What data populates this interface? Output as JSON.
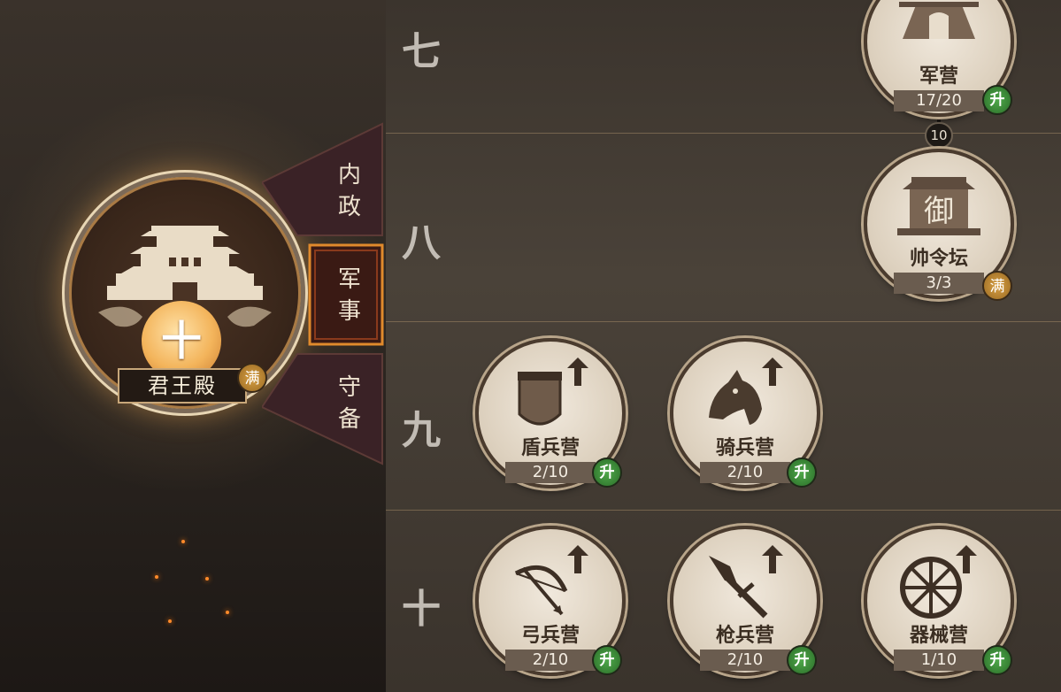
{
  "hall": {
    "name": "君王殿",
    "level": "十",
    "max_badge": "满"
  },
  "tabs": [
    {
      "label_top": "内",
      "label_bottom": "政"
    },
    {
      "label_top": "军",
      "label_bottom": "事"
    },
    {
      "label_top": "守",
      "label_bottom": "备"
    }
  ],
  "rows": [
    "七",
    "八",
    "九",
    "十"
  ],
  "connector": "10",
  "buildings": {
    "barracks": {
      "name": "军营",
      "count": "17/20",
      "badge": "升"
    },
    "command": {
      "name": "帅令坛",
      "count": "3/3",
      "badge": "满"
    },
    "shield": {
      "name": "盾兵营",
      "count": "2/10",
      "badge": "升"
    },
    "cavalry": {
      "name": "骑兵营",
      "count": "2/10",
      "badge": "升"
    },
    "archer": {
      "name": "弓兵营",
      "count": "2/10",
      "badge": "升"
    },
    "spear": {
      "name": "枪兵营",
      "count": "2/10",
      "badge": "升"
    },
    "siege": {
      "name": "器械营",
      "count": "1/10",
      "badge": "升"
    }
  },
  "command_icon_char": "御",
  "colors": {
    "accent": "#e08a2c",
    "upgrade": "#3d8c39",
    "max": "#b8862e"
  }
}
